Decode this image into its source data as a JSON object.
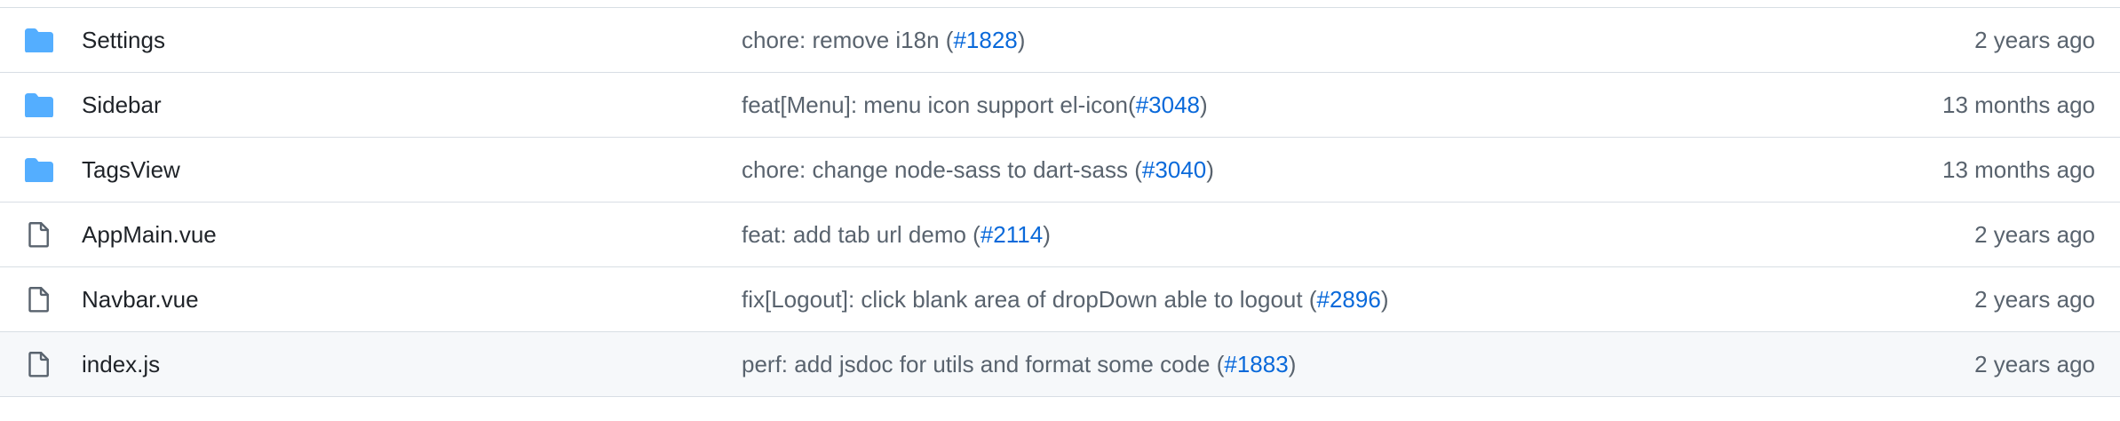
{
  "colors": {
    "folder": "#54aeff",
    "file_icon": "#59636e",
    "link": "#0969da",
    "muted": "#59636e",
    "text": "#1f2328",
    "border": "#d8dee4",
    "hover_bg": "#f6f8fa"
  },
  "rows": [
    {
      "type": "folder",
      "icon": "folder-icon",
      "name": "Settings",
      "message_prefix": "chore: remove i18n (",
      "issue": "#1828",
      "message_suffix": ")",
      "age": "2 years ago"
    },
    {
      "type": "folder",
      "icon": "folder-icon",
      "name": "Sidebar",
      "message_prefix": "feat[Menu]: menu icon support el-icon(",
      "issue": "#3048",
      "message_suffix": ")",
      "age": "13 months ago"
    },
    {
      "type": "folder",
      "icon": "folder-icon",
      "name": "TagsView",
      "message_prefix": "chore: change node-sass to dart-sass (",
      "issue": "#3040",
      "message_suffix": ")",
      "age": "13 months ago"
    },
    {
      "type": "file",
      "icon": "file-icon",
      "name": "AppMain.vue",
      "message_prefix": "feat: add tab url demo (",
      "issue": "#2114",
      "message_suffix": ")",
      "age": "2 years ago"
    },
    {
      "type": "file",
      "icon": "file-icon",
      "name": "Navbar.vue",
      "message_prefix": "fix[Logout]: click blank area of dropDown able to logout (",
      "issue": "#2896",
      "message_suffix": ")",
      "age": "2 years ago"
    },
    {
      "type": "file",
      "icon": "file-icon",
      "name": "index.js",
      "message_prefix": "perf: add jsdoc for utils and format some code (",
      "issue": "#1883",
      "message_suffix": ")",
      "age": "2 years ago"
    }
  ]
}
